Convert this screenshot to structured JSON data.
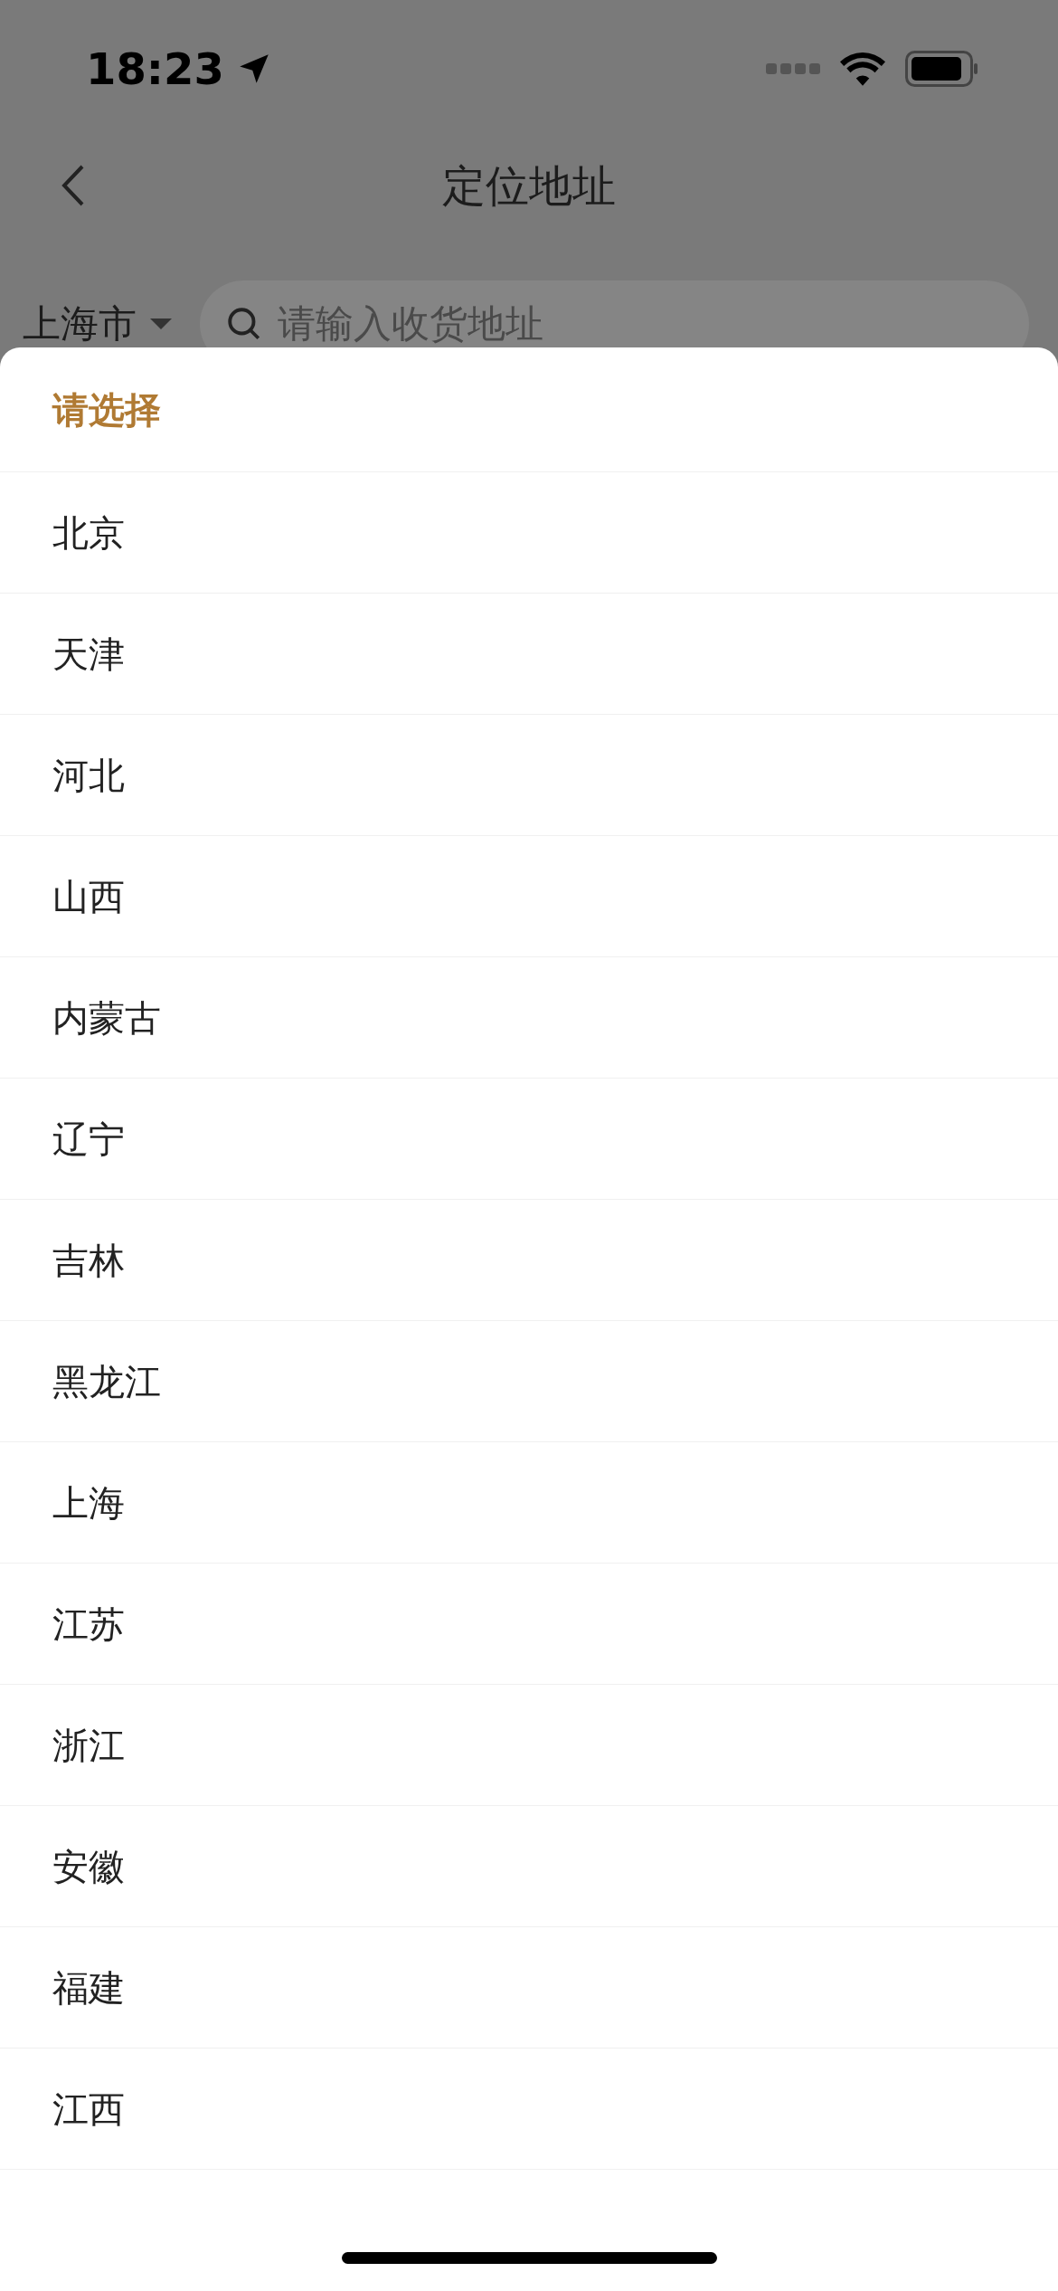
{
  "status_bar": {
    "time": "18:23"
  },
  "nav": {
    "title": "定位地址"
  },
  "search_row": {
    "city": "上海市",
    "placeholder": "请输入收货地址"
  },
  "sheet": {
    "title": "请选择",
    "options": [
      {
        "label": "北京"
      },
      {
        "label": "天津"
      },
      {
        "label": "河北"
      },
      {
        "label": "山西"
      },
      {
        "label": "内蒙古"
      },
      {
        "label": "辽宁"
      },
      {
        "label": "吉林"
      },
      {
        "label": "黑龙江"
      },
      {
        "label": "上海"
      },
      {
        "label": "江苏"
      },
      {
        "label": "浙江"
      },
      {
        "label": "安徽"
      },
      {
        "label": "福建"
      },
      {
        "label": "江西"
      }
    ]
  }
}
